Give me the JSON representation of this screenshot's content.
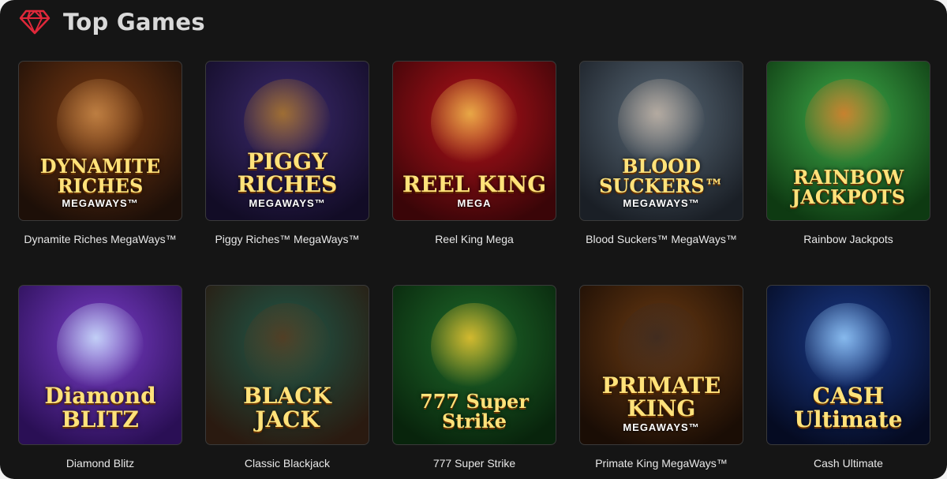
{
  "header": {
    "title": "Top Games",
    "icon": "diamond-icon"
  },
  "colors": {
    "background": "#151515",
    "accent": "#e0283a",
    "text": "#e8e8e8"
  },
  "games": [
    {
      "id": "dynamite-riches",
      "name": "Dynamite Riches MegaWays™",
      "art_title": "DYNAMITE RICHES",
      "art_sub": "MEGAWAYS™",
      "bg1": "#7a3a12",
      "bg2": "#1d0f08",
      "deco": "#c98a4a"
    },
    {
      "id": "piggy-riches",
      "name": "Piggy Riches™ MegaWays™",
      "art_title": "PIGGY RICHES",
      "art_sub": "MEGAWAYS™",
      "bg1": "#3c2a6e",
      "bg2": "#120c26",
      "deco": "#b07a2a"
    },
    {
      "id": "reel-king-mega",
      "name": "Reel King Mega",
      "art_title": "REEL KING",
      "art_sub": "MEGA",
      "bg1": "#b3121a",
      "bg2": "#3a0508",
      "deco": "#f2c24e"
    },
    {
      "id": "blood-suckers",
      "name": "Blood Suckers™ MegaWays™",
      "art_title": "BLOOD SUCKERS™",
      "art_sub": "MEGAWAYS™",
      "bg1": "#5a6a78",
      "bg2": "#1a1f26",
      "deco": "#c4b6a8"
    },
    {
      "id": "rainbow-jackpots",
      "name": "Rainbow Jackpots",
      "art_title": "RAINBOW JACKPOTS",
      "art_sub": "",
      "bg1": "#3fae4a",
      "bg2": "#0e3a12",
      "deco": "#e07a2a"
    },
    {
      "id": "diamond-blitz",
      "name": "Diamond Blitz",
      "art_title": "Diamond BLITZ",
      "art_sub": "",
      "bg1": "#7a3dc9",
      "bg2": "#2a0f55",
      "deco": "#cfe9ff"
    },
    {
      "id": "classic-blackjack",
      "name": "Classic Blackjack",
      "art_title": "BLACK JACK",
      "art_sub": "",
      "bg1": "#1f5a4a",
      "bg2": "#2a1a10",
      "deco": "#5a3a1f"
    },
    {
      "id": "777-super-strike",
      "name": "777 Super Strike",
      "art_title": "777 Super Strike",
      "art_sub": "",
      "bg1": "#1f6a2a",
      "bg2": "#08240c",
      "deco": "#f2c730"
    },
    {
      "id": "primate-king",
      "name": "Primate King MegaWays™",
      "art_title": "PRIMATE KING",
      "art_sub": "MEGAWAYS™",
      "bg1": "#6a3a12",
      "bg2": "#1a0d05",
      "deco": "#3a2a22"
    },
    {
      "id": "cash-ultimate",
      "name": "Cash Ultimate",
      "art_title": "CASH Ultimate",
      "art_sub": "",
      "bg1": "#1a3a8a",
      "bg2": "#050b22",
      "deco": "#9ad0ff"
    }
  ]
}
